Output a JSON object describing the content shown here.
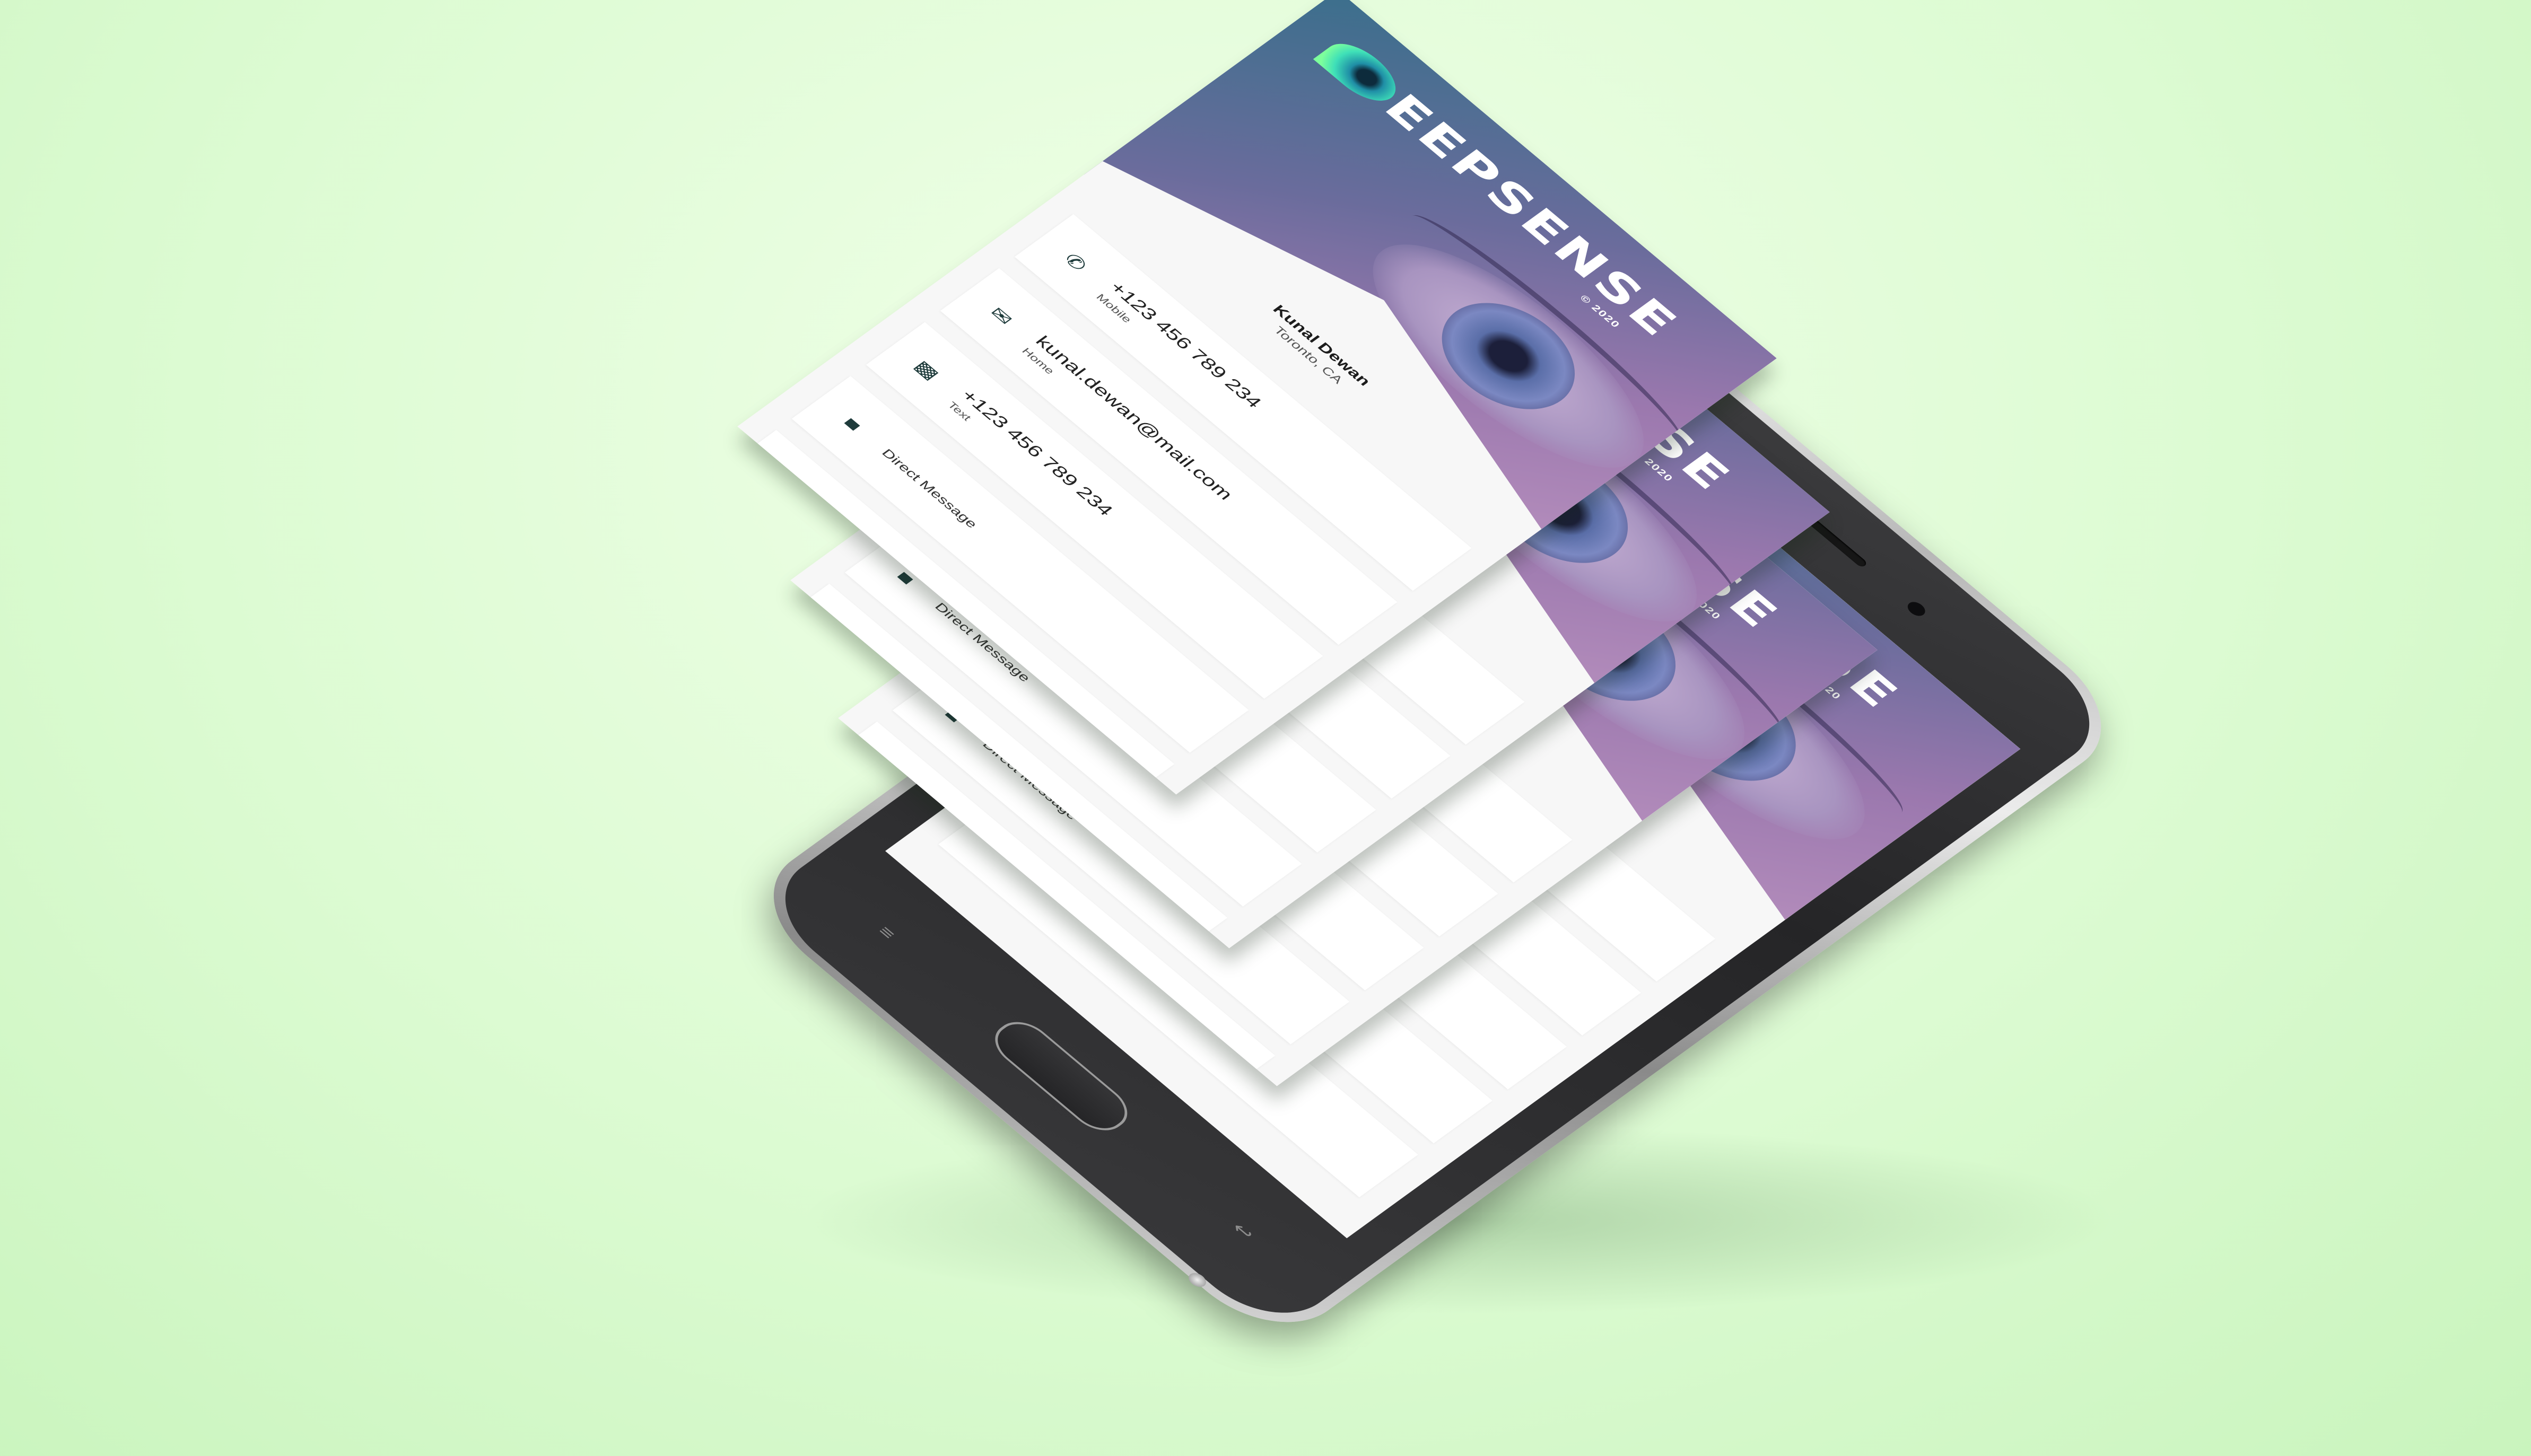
{
  "brand": {
    "logo_text": "EEPSENSE",
    "year": "© 2020"
  },
  "profile": {
    "name": "Kunal Dewan",
    "location": "Toronto, CA"
  },
  "contacts": [
    {
      "icon": "phone-icon",
      "value": "+123 456 789 234",
      "label": "Mobile"
    },
    {
      "icon": "envelope-icon",
      "value": "kunal.dewan@mail.com",
      "label": "Home"
    },
    {
      "icon": "sms-icon",
      "value": "+123 456 789 234",
      "label": "Text"
    }
  ],
  "direct_message": {
    "icon": "chat-bubble-icon",
    "label": "Direct Message"
  },
  "colors": {
    "background": "#dcfbd2",
    "hero_start": "#3b6f8c",
    "hero_end": "#b48dbc",
    "logo_accent": "#3fe0b8",
    "icon_color": "#1e3b3b"
  }
}
